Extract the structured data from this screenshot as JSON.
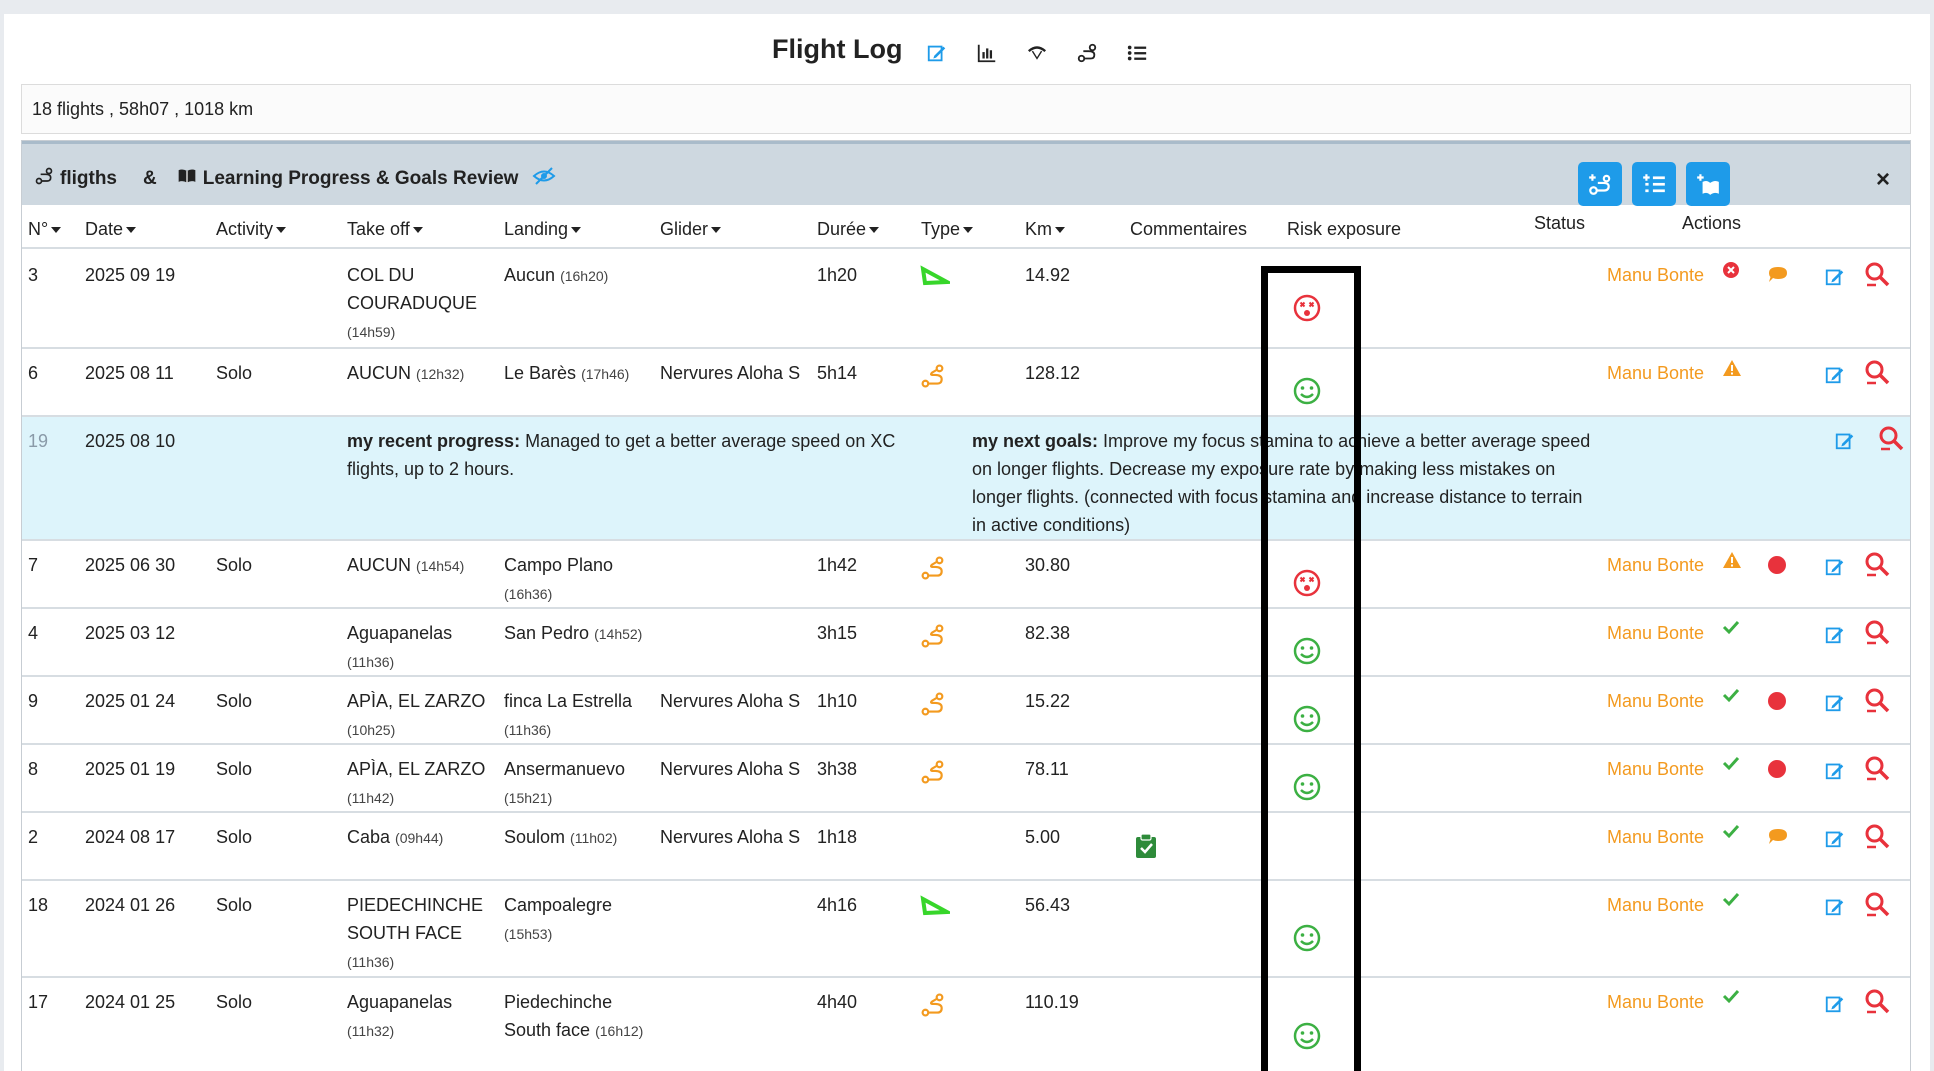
{
  "header": {
    "title": "Flight Log",
    "icons": [
      "edit-icon",
      "chart-icon",
      "wing-icon",
      "route-icon",
      "list-icon"
    ]
  },
  "summary": {
    "text": "18 flights , 58h07 , 1018 km"
  },
  "panel": {
    "title_part1": "fligths",
    "amp": "&",
    "title_part2": "Learning Progress & Goals Review",
    "buttons": [
      "add-flight-button",
      "add-list-button",
      "add-book-button"
    ],
    "close": "×"
  },
  "columns": {
    "num": "N°",
    "date": "Date",
    "activity": "Activity",
    "takeoff": "Take off",
    "landing": "Landing",
    "glider": "Glider",
    "duree": "Durée",
    "type": "Type",
    "km": "Km",
    "comments": "Commentaires",
    "risk": "Risk exposure",
    "status": "Status",
    "actions": "Actions"
  },
  "rows": [
    {
      "num": "3",
      "date": "2025 09 19",
      "activity": "",
      "takeoff": "COL DU COURADUQUE",
      "takeoff_time": "(14h59)",
      "landing": "Aucun",
      "landing_time": "(16h20)",
      "glider": "",
      "duree": "1h20",
      "type": "triangle",
      "km": "14.92",
      "comment": "",
      "risk": "bad",
      "pilot": "Manu Bonte",
      "status": "error",
      "extra": "comment"
    },
    {
      "num": "6",
      "date": "2025 08 11",
      "activity": "Solo",
      "takeoff": "AUCUN",
      "takeoff_time": "(12h32)",
      "landing": "Le Barès",
      "landing_time": "(17h46)",
      "glider": "Nervures Aloha S",
      "duree": "5h14",
      "type": "route",
      "km": "128.12",
      "comment": "",
      "risk": "good",
      "pilot": "Manu Bonte",
      "status": "warning",
      "extra": ""
    },
    {
      "num": "7",
      "date": "2025 06 30",
      "activity": "Solo",
      "takeoff": "AUCUN",
      "takeoff_time": "(14h54)",
      "landing": "Campo Plano",
      "landing_time": "(16h36)",
      "glider": "",
      "duree": "1h42",
      "type": "route",
      "km": "30.80",
      "comment": "",
      "risk": "bad",
      "pilot": "Manu Bonte",
      "status": "warning",
      "extra": "dot"
    },
    {
      "num": "4",
      "date": "2025 03 12",
      "activity": "",
      "takeoff": "Aguapanelas",
      "takeoff_time": "(11h36)",
      "landing": "San Pedro",
      "landing_time": "(14h52)",
      "glider": "",
      "duree": "3h15",
      "type": "route",
      "km": "82.38",
      "comment": "",
      "risk": "good",
      "pilot": "Manu Bonte",
      "status": "ok",
      "extra": ""
    },
    {
      "num": "9",
      "date": "2025 01 24",
      "activity": "Solo",
      "takeoff": "APÌA, EL ZARZO",
      "takeoff_time": "(10h25)",
      "landing": "finca La Estrella",
      "landing_time": "(11h36)",
      "glider": "Nervures Aloha S",
      "duree": "1h10",
      "type": "route",
      "km": "15.22",
      "comment": "",
      "risk": "good",
      "pilot": "Manu Bonte",
      "status": "ok",
      "extra": "dot"
    },
    {
      "num": "8",
      "date": "2025 01 19",
      "activity": "Solo",
      "takeoff": "APÌA, EL ZARZO",
      "takeoff_time": "(11h42)",
      "landing": "Ansermanuevo",
      "landing_time": "(15h21)",
      "glider": "Nervures Aloha S",
      "duree": "3h38",
      "type": "route",
      "km": "78.11",
      "comment": "",
      "risk": "good",
      "pilot": "Manu Bonte",
      "status": "ok",
      "extra": "dot"
    },
    {
      "num": "2",
      "date": "2024 08 17",
      "activity": "Solo",
      "takeoff": "Caba",
      "takeoff_time": "(09h44)",
      "landing": "Soulom",
      "landing_time": "(11h02)",
      "glider": "Nervures Aloha S",
      "duree": "1h18",
      "type": "",
      "km": "5.00",
      "comment": "clipboard",
      "risk": "",
      "pilot": "Manu Bonte",
      "status": "ok",
      "extra": "comment"
    },
    {
      "num": "18",
      "date": "2024 01 26",
      "activity": "Solo",
      "takeoff": "PIEDECHINCHE SOUTH FACE",
      "takeoff_time": "(11h36)",
      "landing": "Campoalegre",
      "landing_time": "(15h53)",
      "glider": "",
      "duree": "4h16",
      "type": "triangle",
      "km": "56.43",
      "comment": "",
      "risk": "good",
      "pilot": "Manu Bonte",
      "status": "ok",
      "extra": ""
    },
    {
      "num": "17",
      "date": "2024 01 25",
      "activity": "Solo",
      "takeoff": "Aguapanelas",
      "takeoff_time": "(11h32)",
      "landing": "Piedechinche South face",
      "landing_time": "(16h12)",
      "glider": "",
      "duree": "4h40",
      "type": "route",
      "km": "110.19",
      "comment": "",
      "risk": "good",
      "pilot": "Manu Bonte",
      "status": "ok",
      "extra": ""
    }
  ],
  "note": {
    "num": "19",
    "date": "2025 08 10",
    "progress_label": "my recent progress:",
    "progress_text": " Managed to get a better average speed on XC flights, up to 2 hours.",
    "goals_label": "my next goals:",
    "goals_text": " Improve my focus stamina to achieve a better average speed on longer flights. Decrease my exposure rate by making less mistakes on longer flights. (connected with focus stamina and increase distance to terrain in active conditions)"
  },
  "colors": {
    "accent": "#1e9be9",
    "pilot": "#f39a1f",
    "good": "#3cb043",
    "bad": "#e8323c",
    "note_bg": "#ddf4fb"
  }
}
